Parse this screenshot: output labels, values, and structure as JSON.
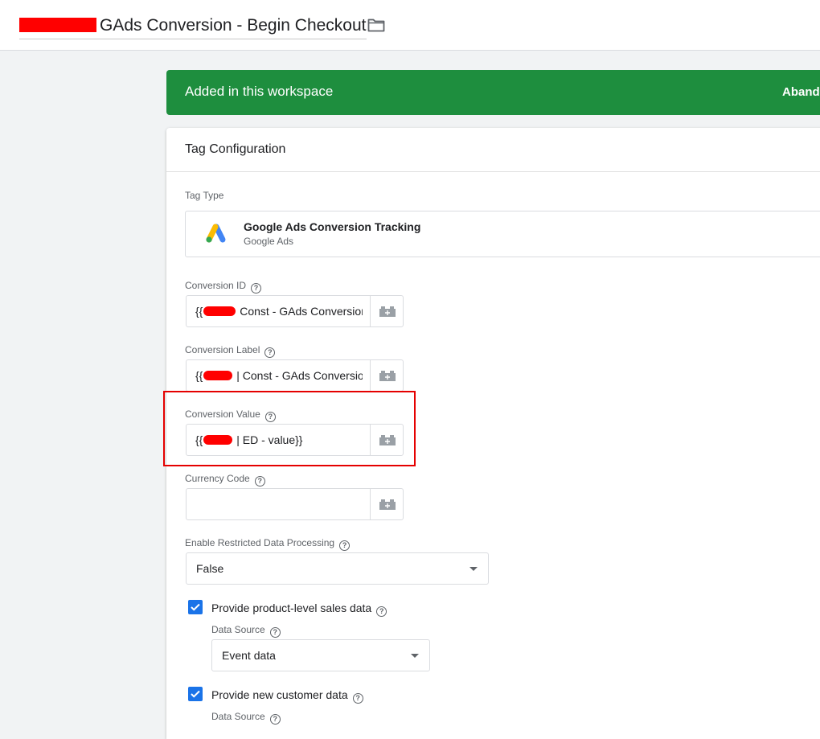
{
  "header": {
    "tag_name": "GAds Conversion - Begin Checkout",
    "folder_icon": "folder-icon"
  },
  "banner": {
    "text": "Added in this workspace",
    "action": "Abandon",
    "color": "#1e8e3e"
  },
  "card": {
    "title": "Tag Configuration",
    "tag_type_label": "Tag Type",
    "tag_type": {
      "name": "Google Ads Conversion Tracking",
      "provider": "Google Ads",
      "icon": "google-ads-icon"
    },
    "fields": {
      "conversion_id": {
        "label": "Conversion ID",
        "value_prefix": "{{",
        "value_suffix": " Const - GAds Conversion ID}}"
      },
      "conversion_label": {
        "label": "Conversion Label",
        "value_prefix": "{{",
        "value_suffix": " | Const - GAds Conversion Label}}"
      },
      "conversion_value": {
        "label": "Conversion Value",
        "value_prefix": "{{",
        "value_suffix": " | ED - value}}"
      },
      "currency_code": {
        "label": "Currency Code",
        "value": ""
      }
    },
    "restricted_data": {
      "label": "Enable Restricted Data Processing",
      "value": "False"
    },
    "product_sales": {
      "label": "Provide product-level sales data",
      "checked": true,
      "data_source_label": "Data Source",
      "data_source_value": "Event data"
    },
    "new_customer": {
      "label": "Provide new customer data",
      "checked": true,
      "data_source_label": "Data Source"
    }
  },
  "colors": {
    "accent_blue": "#1a73e8",
    "highlight_red": "#e50000"
  }
}
